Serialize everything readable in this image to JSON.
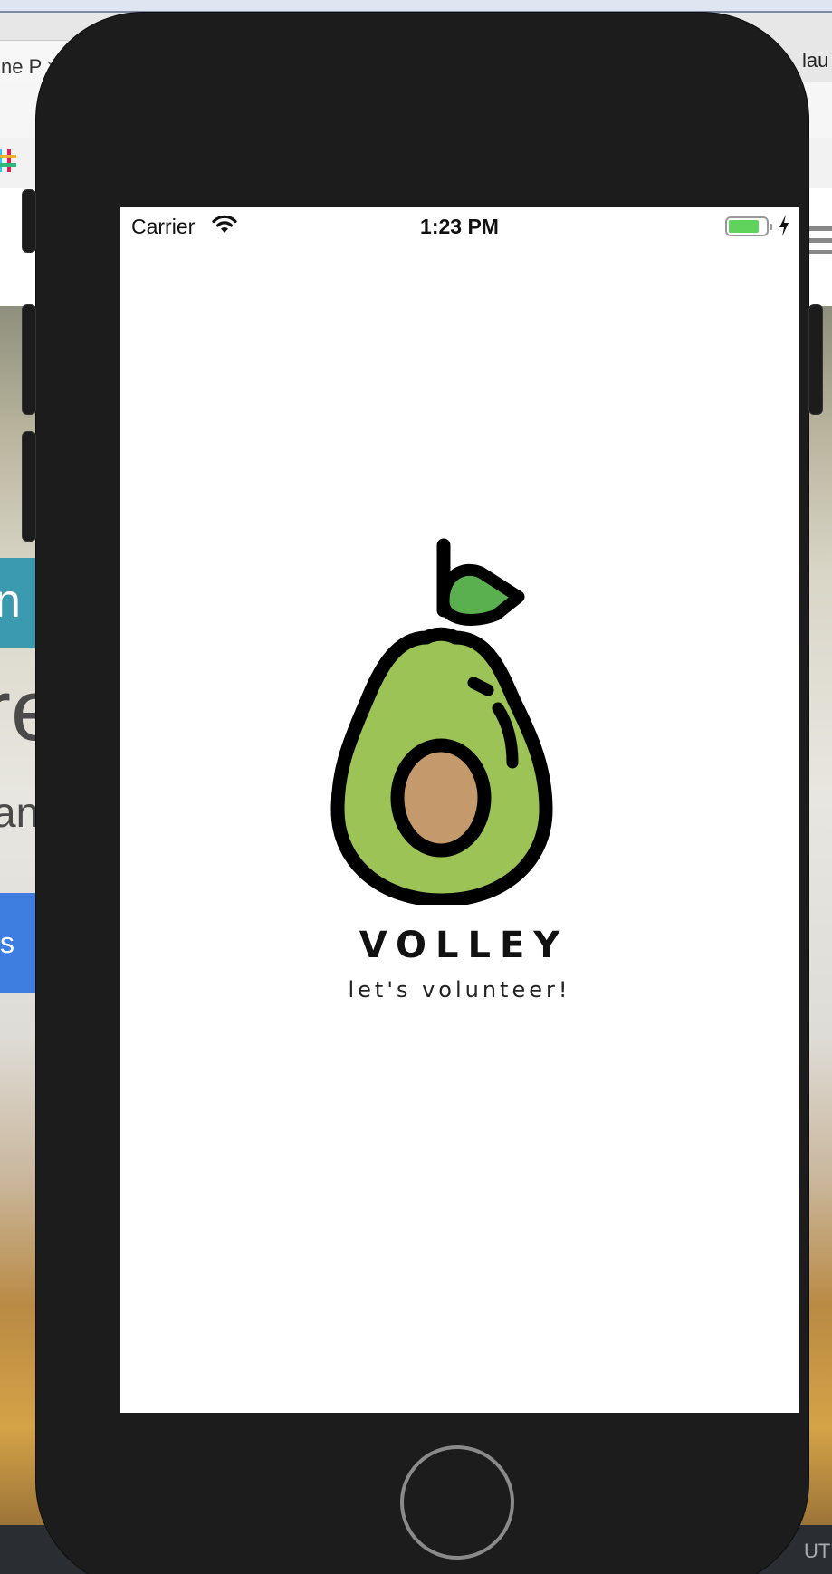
{
  "background_browser": {
    "tab_title": "ne P",
    "tab_close": "×",
    "user_label": "lau",
    "page_fragments": {
      "teal_button": "n",
      "big_heading": "re",
      "subheading": "an",
      "blue_button": "s"
    },
    "bottom_bar_text": "UT"
  },
  "status_bar": {
    "carrier": "Carrier",
    "time": "1:23 PM",
    "wifi_icon": "wifi-icon",
    "battery_icon": "battery-icon",
    "charging_icon": "bolt-icon"
  },
  "splash": {
    "app_name": "VOLLEY",
    "tagline": "let's volunteer!",
    "logo_icon": "avocado-icon"
  },
  "colors": {
    "avocado_flesh": "#9bc356",
    "avocado_pit": "#c49a6c",
    "leaf": "#5ab04f",
    "outline": "#000000",
    "phone_body": "#1c1c1c",
    "battery_fill": "#5fd35b"
  }
}
